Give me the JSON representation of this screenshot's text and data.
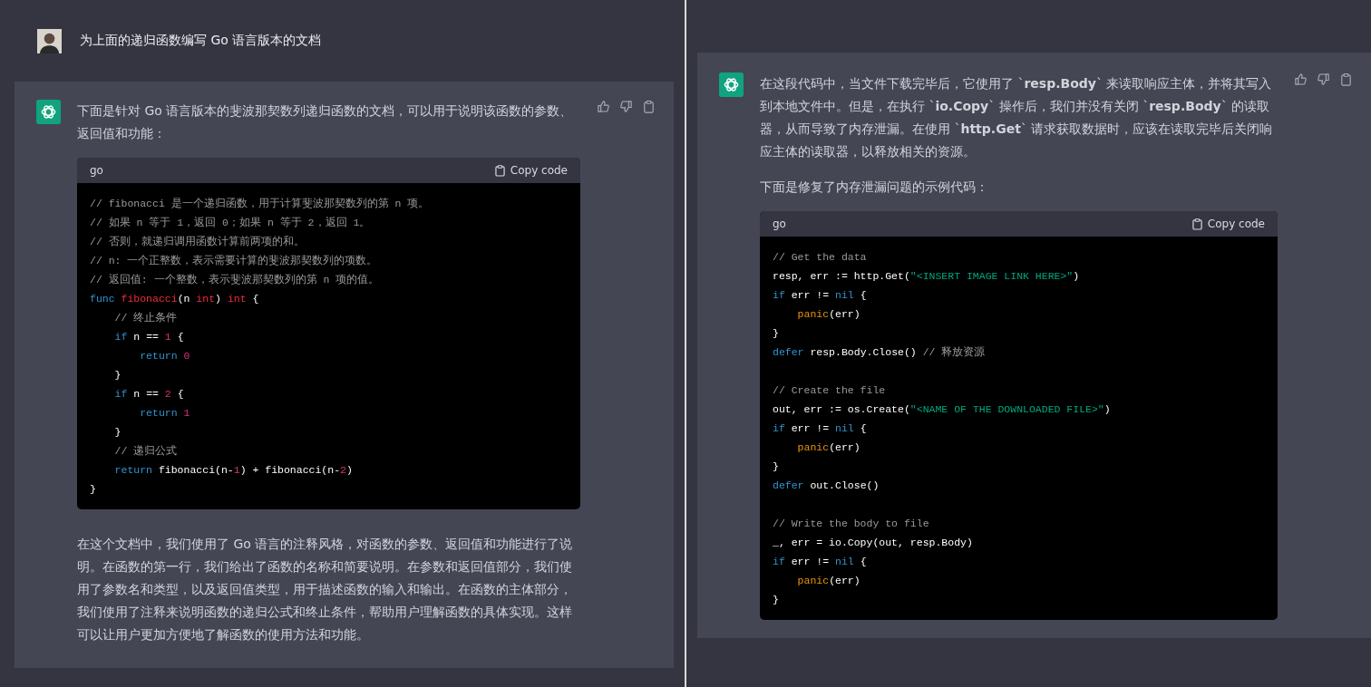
{
  "panels": [
    {
      "user_prompt": "为上面的递归函数编写 Go 语言版本的文档",
      "intro": [
        "下面是针对 Go 语言版本的斐波那契数列递归函数的文档，可以用于说明该函数的参数、返回值和功能："
      ],
      "code": {
        "language": "go",
        "copy_label": "Copy code",
        "lines": [
          {
            "tokens": [
              {
                "kind": "comment",
                "text": "// fibonacci 是一个递归函数，用于计算斐波那契数列的第 n 项。"
              }
            ]
          },
          {
            "tokens": [
              {
                "kind": "comment",
                "text": "// 如果 n 等于 1，返回 0；如果 n 等于 2，返回 1。"
              }
            ]
          },
          {
            "tokens": [
              {
                "kind": "comment",
                "text": "// 否则，就递归调用函数计算前两项的和。"
              }
            ]
          },
          {
            "tokens": [
              {
                "kind": "comment",
                "text": "// n: 一个正整数，表示需要计算的斐波那契数列的项数。"
              }
            ]
          },
          {
            "tokens": [
              {
                "kind": "comment",
                "text": "// 返回值: 一个整数，表示斐波那契数列的第 n 项的值。"
              }
            ]
          },
          {
            "tokens": [
              {
                "kind": "keyword",
                "text": "func "
              },
              {
                "kind": "function",
                "text": "fibonacci"
              },
              {
                "kind": "plain",
                "text": "(n "
              },
              {
                "kind": "function",
                "text": "int"
              },
              {
                "kind": "plain",
                "text": ") "
              },
              {
                "kind": "function",
                "text": "int"
              },
              {
                "kind": "plain",
                "text": " {"
              }
            ]
          },
          {
            "tokens": [
              {
                "kind": "comment",
                "text": "    // 终止条件"
              }
            ]
          },
          {
            "tokens": [
              {
                "kind": "keyword",
                "text": "    if"
              },
              {
                "kind": "plain",
                "text": " n == "
              },
              {
                "kind": "number",
                "text": "1"
              },
              {
                "kind": "plain",
                "text": " {"
              }
            ]
          },
          {
            "tokens": [
              {
                "kind": "keyword",
                "text": "        return "
              },
              {
                "kind": "number",
                "text": "0"
              }
            ]
          },
          {
            "tokens": [
              {
                "kind": "plain",
                "text": "    }"
              }
            ]
          },
          {
            "tokens": [
              {
                "kind": "keyword",
                "text": "    if"
              },
              {
                "kind": "plain",
                "text": " n == "
              },
              {
                "kind": "number",
                "text": "2"
              },
              {
                "kind": "plain",
                "text": " {"
              }
            ]
          },
          {
            "tokens": [
              {
                "kind": "keyword",
                "text": "        return "
              },
              {
                "kind": "number",
                "text": "1"
              }
            ]
          },
          {
            "tokens": [
              {
                "kind": "plain",
                "text": "    }"
              }
            ]
          },
          {
            "tokens": [
              {
                "kind": "comment",
                "text": "    // 递归公式"
              }
            ]
          },
          {
            "tokens": [
              {
                "kind": "keyword",
                "text": "    return"
              },
              {
                "kind": "plain",
                "text": " fibonacci(n-"
              },
              {
                "kind": "number",
                "text": "1"
              },
              {
                "kind": "plain",
                "text": ") + fibonacci(n-"
              },
              {
                "kind": "number",
                "text": "2"
              },
              {
                "kind": "plain",
                "text": ")"
              }
            ]
          },
          {
            "tokens": [
              {
                "kind": "plain",
                "text": "}"
              }
            ]
          }
        ]
      },
      "outro": [
        "在这个文档中，我们使用了 Go 语言的注释风格，对函数的参数、返回值和功能进行了说明。在函数的第一行，我们给出了函数的名称和简要说明。在参数和返回值部分，我们使用了参数名和类型，以及返回值类型，用于描述函数的输入和输出。在函数的主体部分，我们使用了注释来说明函数的递归公式和终止条件，帮助用户理解函数的具体实现。这样可以让用户更加方便地了解函数的使用方法和功能。"
      ]
    },
    {
      "intro": [
        "在这段代码中，当文件下载完毕后，它使用了 `**resp.Body**` 来读取响应主体，并将其写入到本地文件中。但是，在执行 `**io.Copy**` 操作后，我们并没有关闭 `**resp.Body**` 的读取器，从而导致了内存泄漏。在使用 `**http.Get**` 请求获取数据时，应该在读取完毕后关闭响应主体的读取器，以释放相关的资源。",
        "下面是修复了内存泄漏问题的示例代码："
      ],
      "code": {
        "language": "go",
        "copy_label": "Copy code",
        "lines": [
          {
            "tokens": [
              {
                "kind": "comment",
                "text": "// Get the data"
              }
            ]
          },
          {
            "tokens": [
              {
                "kind": "plain",
                "text": "resp, err := http.Get("
              },
              {
                "kind": "string",
                "text": "\"<INSERT IMAGE LINK HERE>\""
              },
              {
                "kind": "plain",
                "text": ")"
              }
            ]
          },
          {
            "tokens": [
              {
                "kind": "keyword",
                "text": "if"
              },
              {
                "kind": "plain",
                "text": " err != "
              },
              {
                "kind": "keyword",
                "text": "nil"
              },
              {
                "kind": "plain",
                "text": " {"
              }
            ]
          },
          {
            "tokens": [
              {
                "kind": "builtin",
                "text": "    panic"
              },
              {
                "kind": "plain",
                "text": "(err)"
              }
            ]
          },
          {
            "tokens": [
              {
                "kind": "plain",
                "text": "}"
              }
            ]
          },
          {
            "tokens": [
              {
                "kind": "keyword",
                "text": "defer"
              },
              {
                "kind": "plain",
                "text": " resp.Body.Close() "
              },
              {
                "kind": "comment",
                "text": "// 释放资源"
              }
            ]
          },
          {
            "gap_before": true,
            "tokens": [
              {
                "kind": "comment",
                "text": "// Create the file"
              }
            ]
          },
          {
            "tokens": [
              {
                "kind": "plain",
                "text": "out, err := os.Create("
              },
              {
                "kind": "string",
                "text": "\"<NAME OF THE DOWNLOADED FILE>\""
              },
              {
                "kind": "plain",
                "text": ")"
              }
            ]
          },
          {
            "tokens": [
              {
                "kind": "keyword",
                "text": "if"
              },
              {
                "kind": "plain",
                "text": " err != "
              },
              {
                "kind": "keyword",
                "text": "nil"
              },
              {
                "kind": "plain",
                "text": " {"
              }
            ]
          },
          {
            "tokens": [
              {
                "kind": "builtin",
                "text": "    panic"
              },
              {
                "kind": "plain",
                "text": "(err)"
              }
            ]
          },
          {
            "tokens": [
              {
                "kind": "plain",
                "text": "}"
              }
            ]
          },
          {
            "tokens": [
              {
                "kind": "keyword",
                "text": "defer"
              },
              {
                "kind": "plain",
                "text": " out.Close()"
              }
            ]
          },
          {
            "gap_before": true,
            "tokens": [
              {
                "kind": "comment",
                "text": "// Write the body to file"
              }
            ]
          },
          {
            "tokens": [
              {
                "kind": "plain",
                "text": "_, err = io.Copy(out, resp.Body)"
              }
            ]
          },
          {
            "tokens": [
              {
                "kind": "keyword",
                "text": "if"
              },
              {
                "kind": "plain",
                "text": " err != "
              },
              {
                "kind": "keyword",
                "text": "nil"
              },
              {
                "kind": "plain",
                "text": " {"
              }
            ]
          },
          {
            "tokens": [
              {
                "kind": "builtin",
                "text": "    panic"
              },
              {
                "kind": "plain",
                "text": "(err)"
              }
            ]
          },
          {
            "tokens": [
              {
                "kind": "plain",
                "text": "}"
              }
            ]
          }
        ]
      }
    }
  ]
}
